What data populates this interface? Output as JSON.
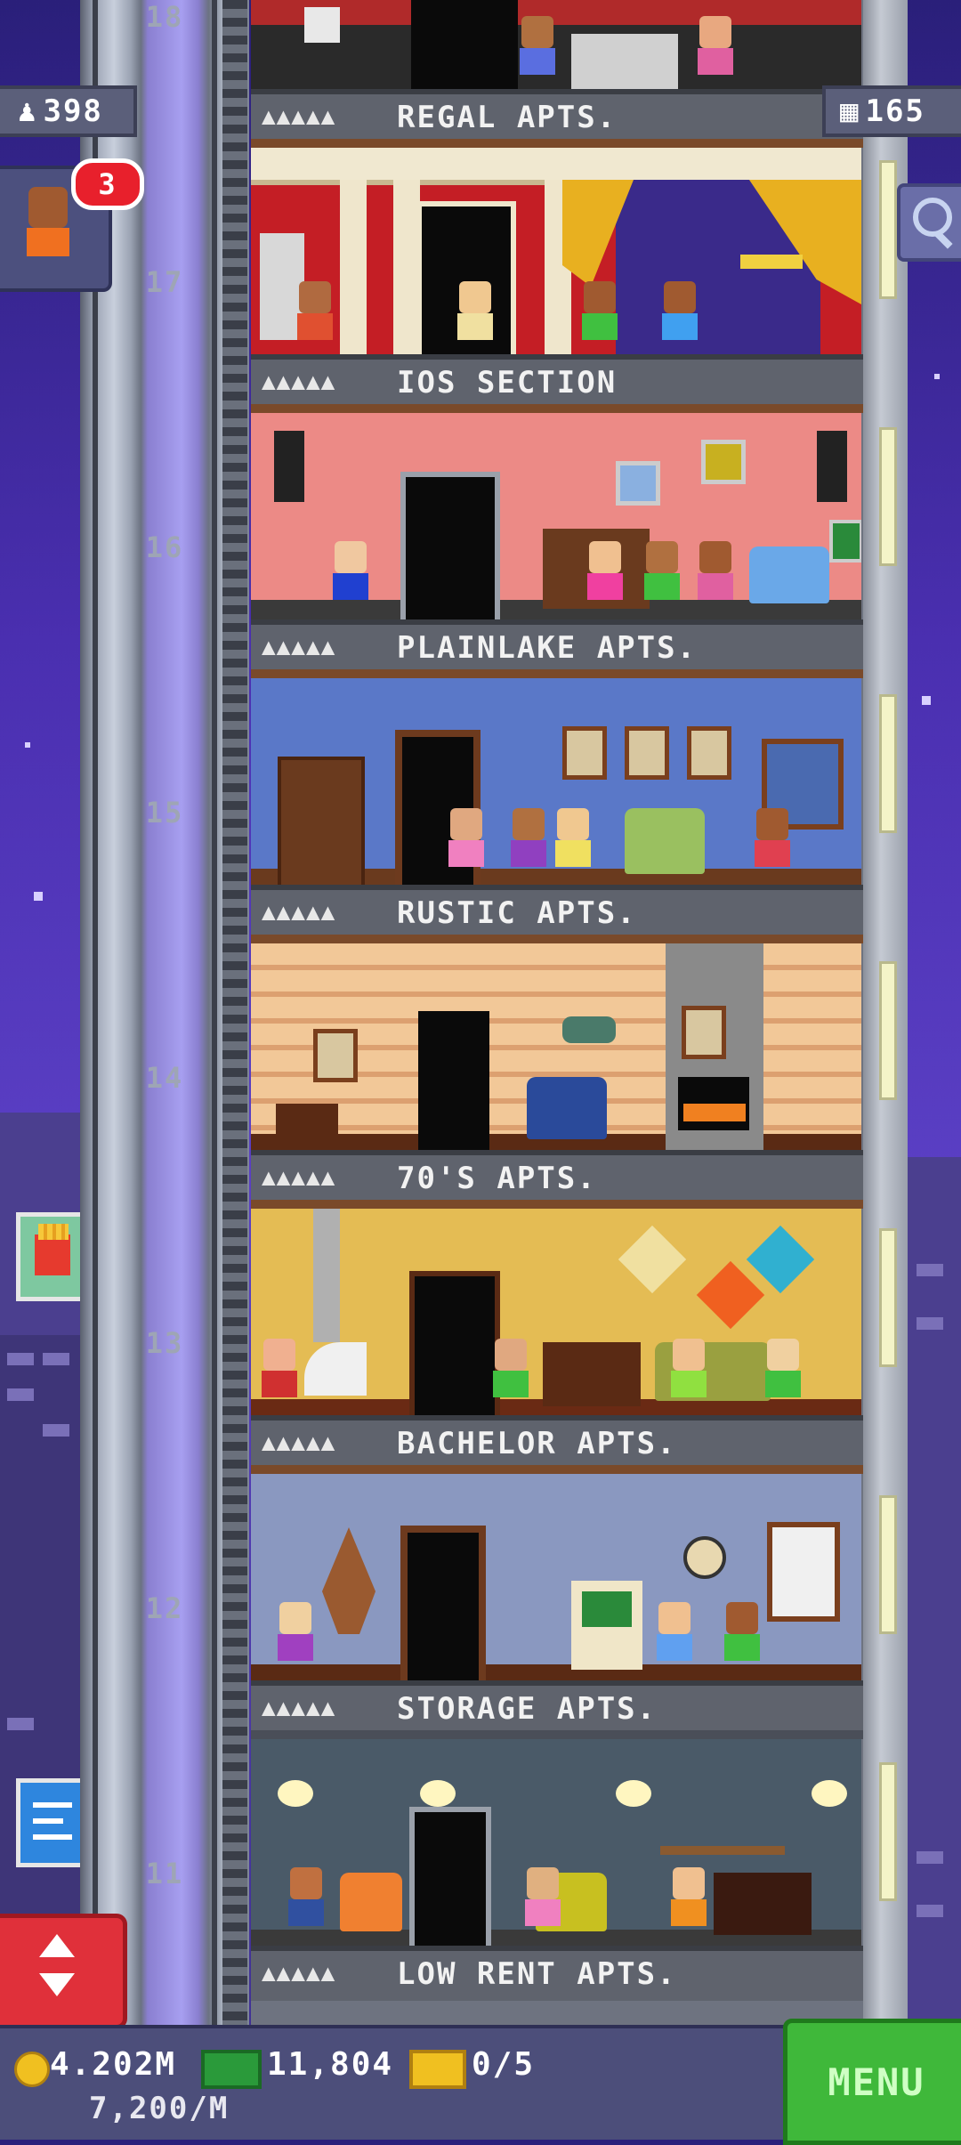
{
  "hud": {
    "population": "398",
    "floors": "165",
    "notification_count": "3"
  },
  "floors": [
    {
      "number": "18",
      "name": "REGAL APTS.",
      "stars": "▲▲▲▲▲"
    },
    {
      "number": "17",
      "name": "IOS SECTION",
      "stars": "▲▲▲▲▲"
    },
    {
      "number": "16",
      "name": "PLAINLAKE APTS.",
      "stars": "▲▲▲▲▲"
    },
    {
      "number": "15",
      "name": "RUSTIC APTS.",
      "stars": "▲▲▲▲▲"
    },
    {
      "number": "14",
      "name": "70'S APTS.",
      "stars": "▲▲▲▲▲"
    },
    {
      "number": "13",
      "name": "BACHELOR APTS.",
      "stars": "▲▲▲▲▲"
    },
    {
      "number": "12",
      "name": "STORAGE APTS.",
      "stars": "▲▲▲▲▲"
    },
    {
      "number": "11",
      "name": "LOW RENT APTS.",
      "stars": "▲▲▲▲▲"
    }
  ],
  "status": {
    "coins": "4.202M",
    "coin_rate": "7,200/M",
    "bux": "11,804",
    "tickets": "0/5"
  },
  "menu_label": "MENU",
  "colors": {
    "sky": "#4a2fb0",
    "menu_green": "#3fb83a",
    "badge_red": "#e8202c",
    "elevator_red": "#e0303a"
  }
}
